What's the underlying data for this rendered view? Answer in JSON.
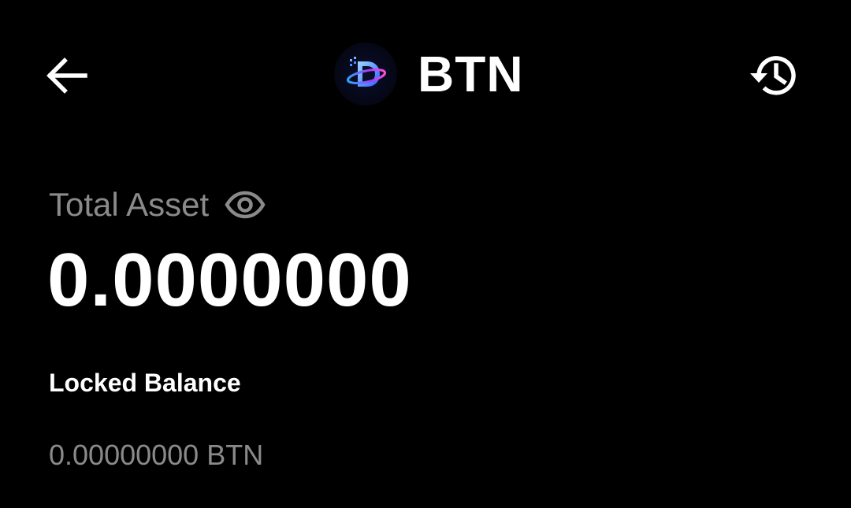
{
  "header": {
    "title": "BTN",
    "back_icon": "arrow-left-icon",
    "history_icon": "history-icon",
    "logo_icon": "btn-token-logo"
  },
  "asset": {
    "label": "Total Asset",
    "visibility_icon": "eye-icon",
    "value": "0.0000000"
  },
  "locked": {
    "label": "Locked Balance",
    "value": "0.00000000 BTN"
  },
  "colors": {
    "background": "#000000",
    "primary_text": "#ffffff",
    "secondary_text": "#8a8a8a"
  }
}
